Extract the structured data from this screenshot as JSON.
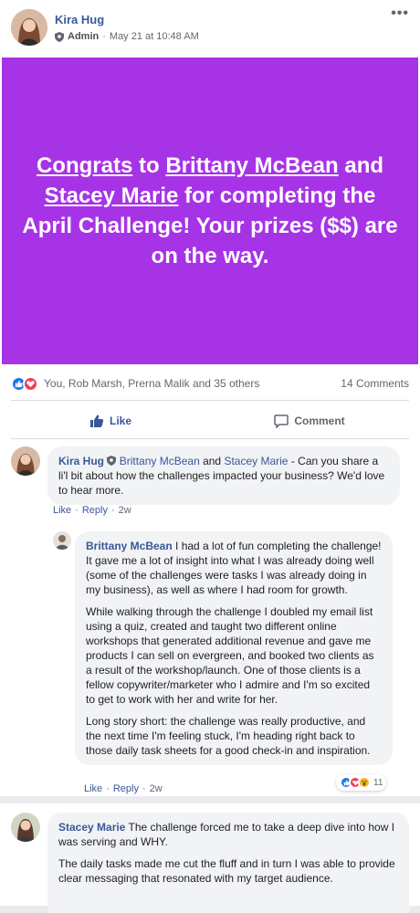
{
  "post": {
    "author": "Kira Hug",
    "role": "Admin",
    "time": "May 21 at 10:48 AM",
    "banner": {
      "prefix_link": "Congrats",
      "text1": " to ",
      "link1": "Brittany McBean",
      "text2": " and ",
      "link2": "Stacey Marie",
      "text3": " for completing the April Challenge! Your prizes ($$) are on the way.",
      "bg_color": "#a733e6"
    },
    "reactors": "You, Rob Marsh, Prerna Malik and 35 others",
    "comments_count": "14 Comments"
  },
  "actions": {
    "like": "Like",
    "comment": "Comment"
  },
  "comments": [
    {
      "author": "Kira Hug",
      "tag1": "Brittany McBean",
      "and": " and ",
      "tag2": "Stacey Marie",
      "text": " - Can you share a li'l bit about how the challenges impacted your business? We'd love to hear more.",
      "like": "Like",
      "reply": "Reply",
      "time": "2w"
    },
    {
      "author": "Brittany McBean",
      "p1": " I had a lot of fun completing the challenge! It gave me a lot of insight into what I was already doing well (some of the challenges were tasks I was already doing in my business), as well as where I had room for growth.",
      "p2": "While walking through the challenge I doubled my email list using a quiz, created and taught two different online workshops that generated additional revenue and gave me products I can sell on evergreen, and booked two clients as a result of the workshop/launch. One of those clients is a fellow copywriter/marketer who I admire and I'm so excited to get to work with her and write for her.",
      "p3": "Long story short: the challenge was really productive, and the next time I'm feeling stuck, I'm heading right back to those daily task sheets for a good check-in and inspiration.",
      "like": "Like",
      "reply": "Reply",
      "time": "2w",
      "reaction_count": "11"
    },
    {
      "author": "Stacey Marie",
      "p1": " The challenge forced me to take a deep dive into how I was serving and WHY.",
      "p2": "The daily tasks made me cut the fluff and in turn I was able to provide clear messaging that resonated with my target audience."
    }
  ]
}
